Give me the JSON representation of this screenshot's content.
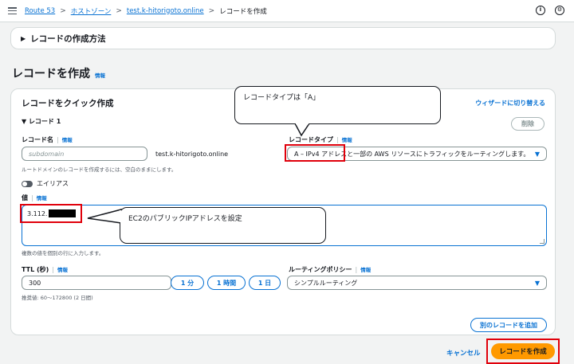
{
  "breadcrumb": {
    "items": [
      "Route 53",
      "ホストゾーン",
      "test.k-hitorigoto.online"
    ],
    "current": "レコードを作成",
    "separator": ">"
  },
  "top_icons": [
    "info-circle-icon",
    "settings-icon"
  ],
  "method_panel": {
    "label": "レコードの作成方法"
  },
  "page": {
    "title": "レコードを作成",
    "info": "情報"
  },
  "quick_create": {
    "title": "レコードをクイック作成",
    "wizard_link": "ウィザードに切り替える",
    "record_header": "レコード 1",
    "delete_button": "削除"
  },
  "record_name": {
    "label": "レコード名",
    "info": "情報",
    "placeholder": "subdomain",
    "suffix": "test.k-hitorigoto.online",
    "hint": "ルートドメインのレコードを作成するには、空白のままにします。"
  },
  "record_type": {
    "label": "レコードタイプ",
    "info": "情報",
    "selected": "A – IPv4 アドレスと一部の AWS リソースにトラフィックをルーティングします。"
  },
  "alias": {
    "label": "エイリアス"
  },
  "value": {
    "label": "値",
    "info": "情報",
    "content": "3.112.",
    "hint": "複数の値を個別の行に入力します。"
  },
  "ttl": {
    "label": "TTL (秒)",
    "info": "情報",
    "value": "300",
    "buttons": [
      "1 分",
      "1 時間",
      "1 日"
    ],
    "hint": "推奨値: 60～172800 (2 日間)"
  },
  "routing_policy": {
    "label": "ルーティングポリシー",
    "info": "情報",
    "selected": "シンプルルーティング"
  },
  "add_record_button": "別のレコードを追加",
  "footer": {
    "cancel": "キャンセル",
    "create": "レコードを作成"
  },
  "annotations": {
    "callout_record_type": "レコードタイプは「A」",
    "callout_value": "EC2のパブリックIPアドレスを設定"
  },
  "colors": {
    "accent": "#0972d3",
    "primary": "#ff9900",
    "highlight": "#e0000b"
  }
}
